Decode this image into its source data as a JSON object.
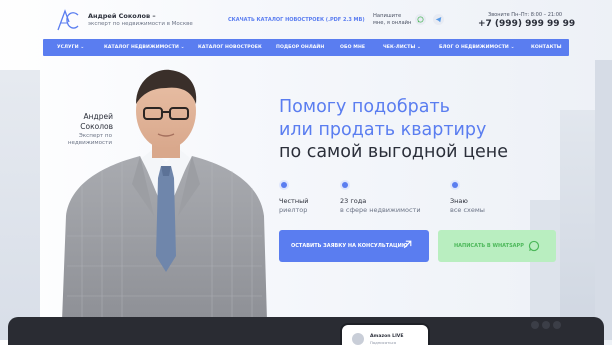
{
  "brand": {
    "name": "Андрей Соколов –",
    "tagline": "эксперт по недвижимости в Москве",
    "logo_letters": "AC"
  },
  "header": {
    "download_link": "СКАЧАТЬ КАТАЛОГ НОВОСТРОЕК (.PDF 2.3 MB)",
    "write_me": "Напишите мне, я онлайн",
    "call_hours": "Звоните Пн–Пт: 8:00 – 21:00",
    "phone": "+7 (999) 999 99 99"
  },
  "nav": {
    "items": [
      {
        "label": "УСЛУГИ",
        "has_dropdown": true
      },
      {
        "label": "КАТАЛОГ НЕДВИЖИМОСТИ",
        "has_dropdown": true
      },
      {
        "label": "КАТАЛОГ НОВОСТРОЕК",
        "has_dropdown": false
      },
      {
        "label": "ПОДБОР ОНЛАЙН",
        "has_dropdown": false
      },
      {
        "label": "ОБО МНЕ",
        "has_dropdown": false
      },
      {
        "label": "ЧЕК-ЛИСТЫ",
        "has_dropdown": true
      },
      {
        "label": "БЛОГ О НЕДВИЖИМОСТИ",
        "has_dropdown": true
      },
      {
        "label": "КОНТАКТЫ",
        "has_dropdown": false
      }
    ]
  },
  "hero": {
    "person_first": "Андрей",
    "person_last": "Соколов",
    "person_role": "Эксперт по недвижимости",
    "headline_line1": "Помогу подобрать",
    "headline_line2": "или продать квартиру",
    "headline_line3": "по самой выгодной цене",
    "features": [
      {
        "title": "Честный",
        "subtitle": "риелтор"
      },
      {
        "title": "23 года",
        "subtitle": "в сфере недвижимости"
      },
      {
        "title": "Знаю",
        "subtitle": "все схемы"
      }
    ],
    "cta_primary": "ОСТАВИТЬ ЗАЯВКУ НА КОНСУЛЬТАЦИЮ",
    "cta_whatsapp": "НАПИСАТЬ В WHATSAPP"
  },
  "bottom": {
    "card_title": "Amazon LIVE",
    "card_sub": "Подписаться"
  },
  "colors": {
    "accent": "#5a7df0",
    "whatsapp_bg": "#b9eec0",
    "whatsapp_text": "#4db85a",
    "dark": "#2b2f3a"
  },
  "icons": [
    "whatsapp-icon",
    "telegram-icon",
    "arrow-up-right-icon",
    "chevron-down-icon"
  ]
}
